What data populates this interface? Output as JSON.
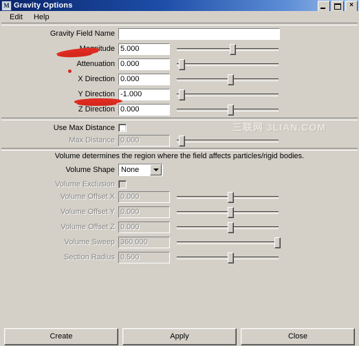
{
  "window": {
    "title": "Gravity Options",
    "icon": "maya-app-icon",
    "buttons": {
      "minimize": "minimize-icon",
      "maximize": "maximize-icon",
      "close": "×"
    }
  },
  "menubar": {
    "items": [
      {
        "label": "Edit"
      },
      {
        "label": "Help"
      }
    ]
  },
  "watermark": {
    "text": "三联网 3LIAN.COM"
  },
  "attributes": {
    "rows": [
      {
        "label": "Gravity Field Name",
        "value": "",
        "wide": true,
        "slider": false,
        "enabled": true
      },
      {
        "label": "Magnitude",
        "value": "5.000",
        "slider": true,
        "slider_pct": 52,
        "enabled": true
      },
      {
        "label": "Attenuation",
        "value": "0.000",
        "slider": true,
        "slider_pct": 2,
        "enabled": true
      },
      {
        "label": "X Direction",
        "value": "0.000",
        "slider": true,
        "slider_pct": 50,
        "enabled": true
      },
      {
        "label": "Y Direction",
        "value": "-1.000",
        "slider": true,
        "slider_pct": 2,
        "enabled": true
      },
      {
        "label": "Z Direction",
        "value": "0.000",
        "slider": true,
        "slider_pct": 50,
        "enabled": true
      }
    ]
  },
  "max_distance": {
    "use_label": "Use Max Distance",
    "use_checked": false,
    "rows": [
      {
        "label": "Max Distance",
        "value": "0.000",
        "slider": true,
        "slider_pct": 2,
        "enabled": false
      }
    ]
  },
  "volume": {
    "description": "Volume determines the region where the field affects particles/rigid bodies.",
    "shape_label": "Volume Shape",
    "shape_value": "None",
    "shape_options": [
      "None"
    ],
    "exclusion_label": "Volume Exclusion",
    "exclusion_checked": false,
    "rows": [
      {
        "label": "Volume Offset X",
        "value": "0.000",
        "slider": true,
        "slider_pct": 50,
        "enabled": false
      },
      {
        "label": "Volume Offset Y",
        "value": "0.000",
        "slider": true,
        "slider_pct": 50,
        "enabled": false
      },
      {
        "label": "Volume Offset Z",
        "value": "0.000",
        "slider": true,
        "slider_pct": 50,
        "enabled": false
      },
      {
        "label": "Volume Sweep",
        "value": "360.000",
        "slider": true,
        "slider_pct": 97,
        "enabled": false
      },
      {
        "label": "Section Radius",
        "value": "0.500",
        "slider": true,
        "slider_pct": 50,
        "enabled": false
      }
    ]
  },
  "footer": {
    "buttons": [
      {
        "label": "Create"
      },
      {
        "label": "Apply"
      },
      {
        "label": "Close"
      }
    ]
  },
  "colors": {
    "face": "#d4d0c8",
    "title_start": "#0a246a",
    "title_end": "#a5c2ea",
    "annotation_red": "#e02b20"
  }
}
